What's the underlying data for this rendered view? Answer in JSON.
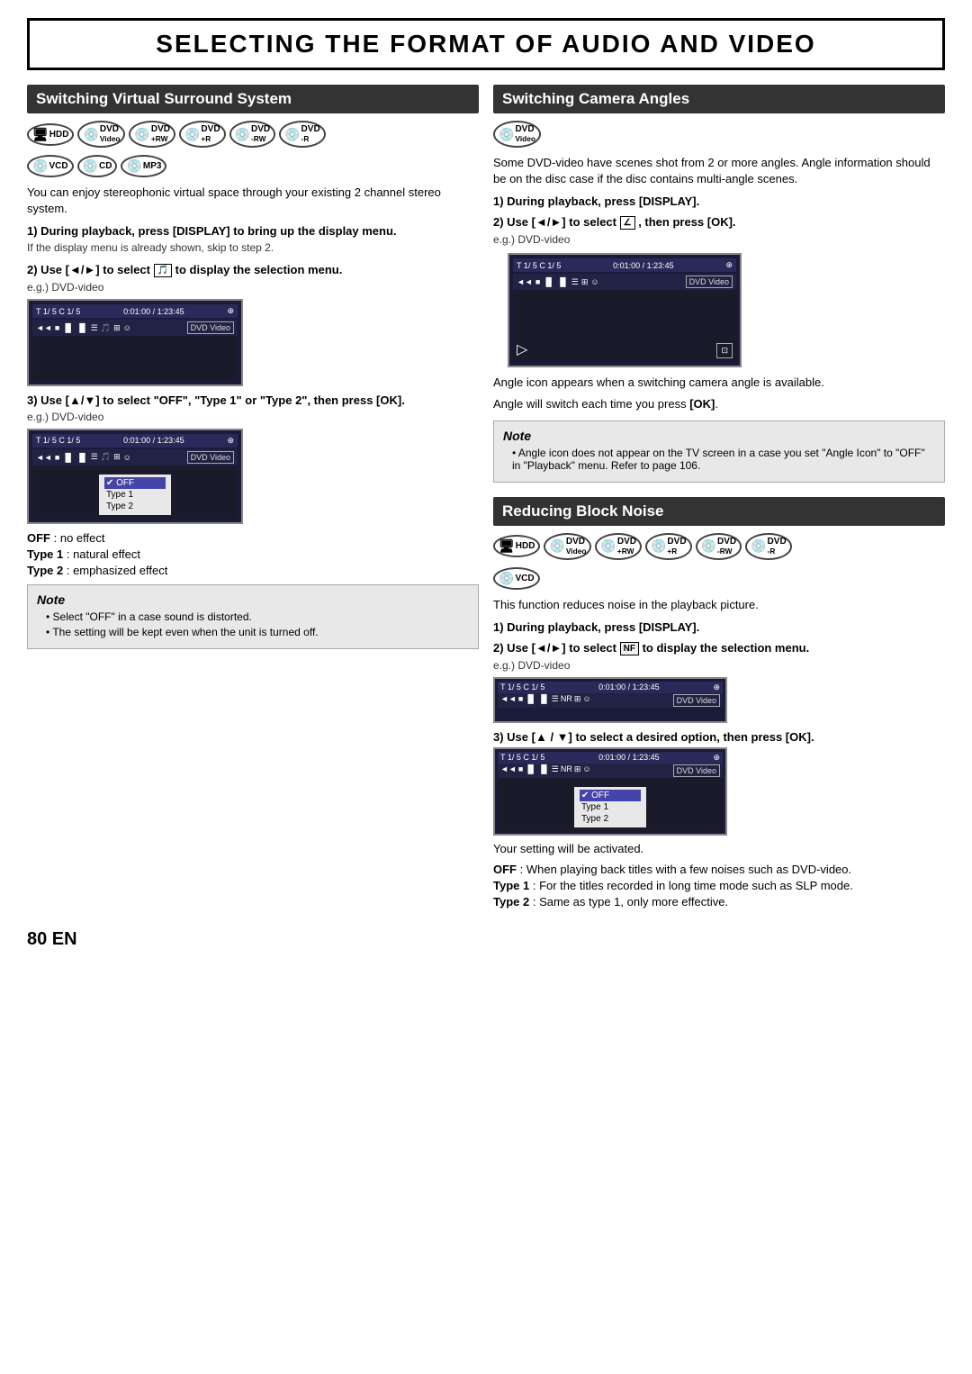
{
  "page": {
    "title": "SELECTING THE FORMAT OF AUDIO AND VIDEO",
    "page_number": "80  EN"
  },
  "left_section": {
    "header": "Switching Virtual Surround System",
    "disc_icons": [
      "HDD",
      "DVD Video",
      "DVD +RW",
      "DVD +R",
      "DVD -RW",
      "DVD -R",
      "VCD",
      "CD",
      "MP3"
    ],
    "intro_text": "You can enjoy stereophonic virtual space through your existing 2 channel stereo system.",
    "step1_title": "1) During playback, press [DISPLAY] to bring up the display menu.",
    "step1_sub": "If the display menu is already shown, skip to step 2.",
    "step2_title": "2) Use [◄/►] to select  to display the selection menu.",
    "step2_eg": "e.g.) DVD-video",
    "step3_title": "3) Use [▲/▼] to select \"OFF\", \"Type 1\" or \"Type 2\", then press [OK].",
    "step3_eg": "e.g.) DVD-video",
    "screen1": {
      "top_left": "T  1/ 5  C  1/ 5",
      "top_right": "0:01:00 / 1:23:45",
      "dvd_badge": "DVD Video"
    },
    "screen2": {
      "top_left": "T  1/ 5  C  1/ 5",
      "top_right": "0:01:00 / 1:23:45",
      "dvd_badge": "DVD Video",
      "menu_items": [
        "✔ OFF",
        "Type 1",
        "Type 2"
      ]
    },
    "off_label": "OFF",
    "off_desc": ": no effect",
    "type1_label": "Type 1",
    "type1_desc": ": natural effect",
    "type2_label": "Type 2",
    "type2_desc": ": emphasized effect",
    "note": {
      "title": "Note",
      "items": [
        "Select \"OFF\" in a case sound is distorted.",
        "The setting will be kept even when the unit is turned off."
      ]
    }
  },
  "right_top_section": {
    "header": "Switching Camera Angles",
    "disc_icons": [
      "DVD Video"
    ],
    "intro_text": "Some DVD-video have scenes shot from 2 or more angles. Angle information should be on the disc case if the disc contains multi-angle scenes.",
    "step1_title": "1) During playback, press [DISPLAY].",
    "step2_title": "2) Use [◄/►] to select  , then press [OK].",
    "step2_eg": "e.g.) DVD-video",
    "angle_screen": {
      "top_left": "T  1/ 5  C  1/ 5",
      "top_right": "0:01:00 / 1:23:45",
      "dvd_badge": "DVD Video"
    },
    "after_screen1": "Angle icon appears when a switching camera angle is available.",
    "after_screen2": "Angle will switch each time you press [OK].",
    "note": {
      "title": "Note",
      "items": [
        "Angle icon does not appear on the TV screen in a case you set \"Angle Icon\" to \"OFF\" in \"Playback\" menu. Refer to page 106."
      ]
    }
  },
  "right_bottom_section": {
    "header": "Reducing Block Noise",
    "disc_icons": [
      "HDD",
      "DVD Video",
      "DVD +RW",
      "DVD +R",
      "DVD -RW",
      "DVD -R",
      "VCD"
    ],
    "intro_text": "This function reduces noise in the playback picture.",
    "step1_title": "1) During playback, press [DISPLAY].",
    "step2_title": "2) Use [◄/►] to select  NF  to display the selection menu.",
    "step2_eg": "e.g.) DVD-video",
    "screen1": {
      "top_left": "T  1/ 5  C  1/ 5",
      "top_right": "0:01:00 / 1:23:45",
      "dvd_badge": "DVD Video"
    },
    "step3_title": "3) Use [▲ / ▼] to select a desired option, then press [OK].",
    "screen2": {
      "top_left": "T  1/ 5  C  1/ 5",
      "top_right": "0:01:00 / 1:23:45",
      "dvd_badge": "DVD Video",
      "menu_items": [
        "✔ OFF",
        "Type 1",
        "Type 2"
      ]
    },
    "after_text": "Your setting will be activated.",
    "off_label": "OFF",
    "off_desc": ": When playing back titles with a few noises such as DVD-video.",
    "type1_label": "Type 1",
    "type1_desc": ": For the titles recorded in long time mode such as SLP mode.",
    "type2_label": "Type 2",
    "type2_desc": ": Same as type 1, only more effective."
  }
}
